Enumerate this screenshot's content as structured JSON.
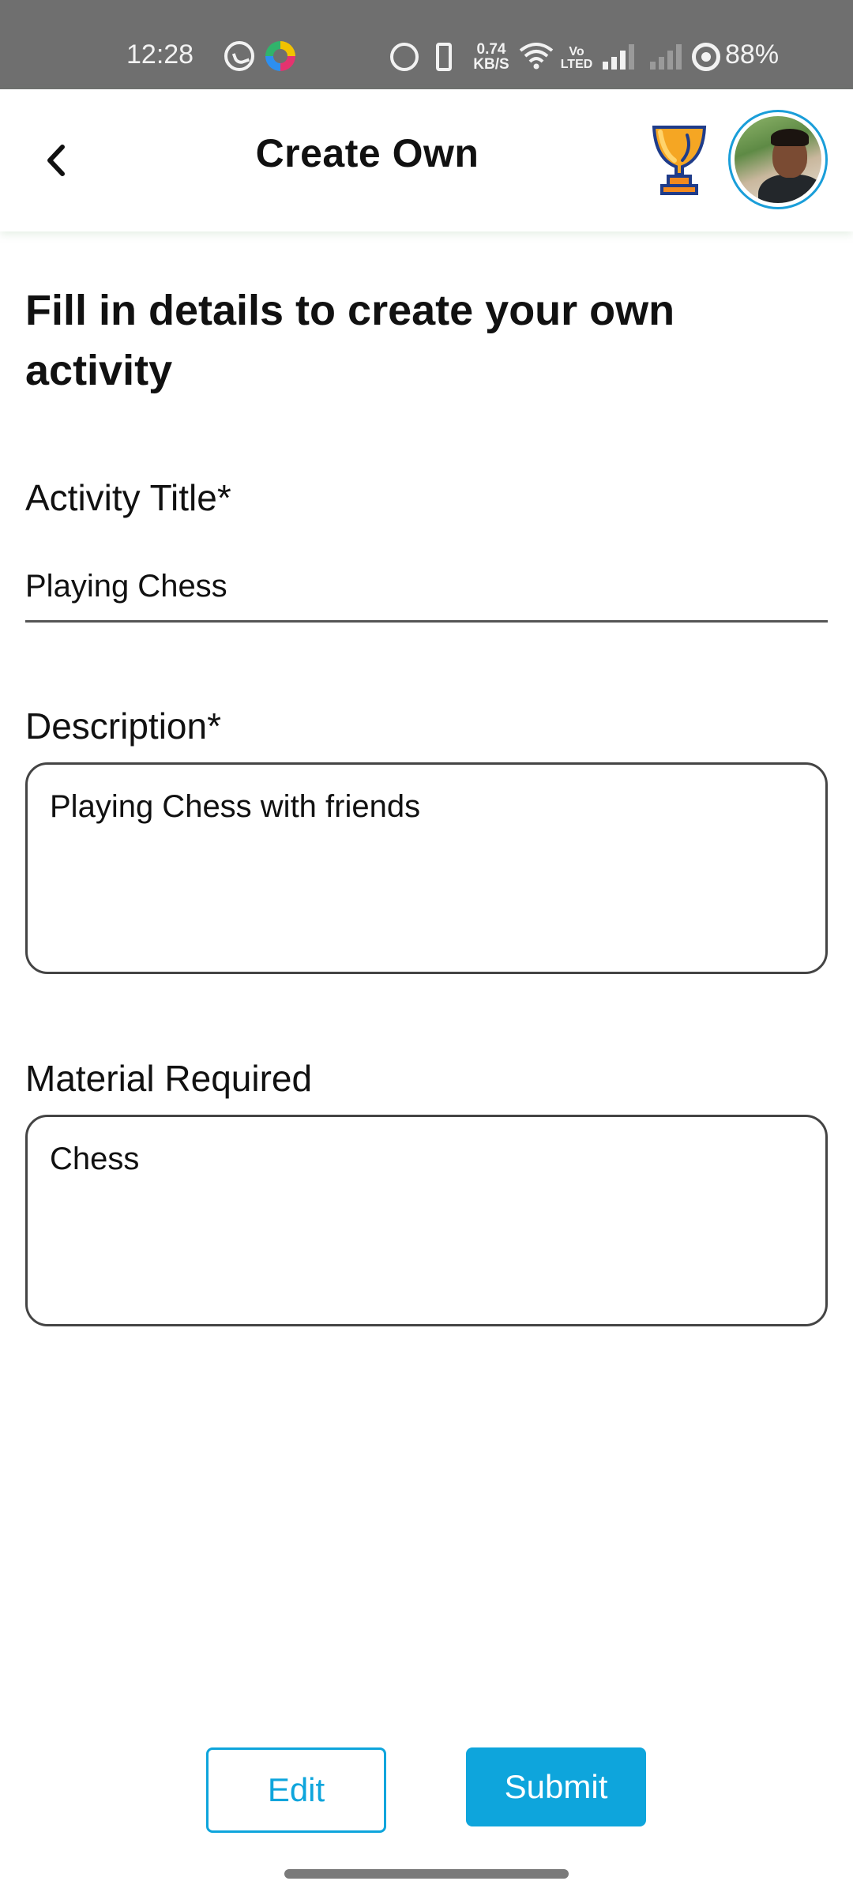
{
  "status_bar": {
    "time": "12:28",
    "speed_value": "0.74",
    "speed_unit": "KB/S",
    "volte_top": "Vo",
    "volte_bottom": "LTED",
    "battery": "88%"
  },
  "header": {
    "title": "Create Own",
    "back_icon": "chevron-left-icon",
    "trophy_icon": "trophy-icon"
  },
  "form": {
    "intro": "Fill in details to create your own activity",
    "activity_title_label": "Activity Title*",
    "activity_title_value": "Playing Chess",
    "description_label": "Description*",
    "description_value": "Playing Chess with friends",
    "material_label": "Material Required",
    "material_value": "Chess"
  },
  "actions": {
    "edit_label": "Edit",
    "submit_label": "Submit"
  },
  "colors": {
    "accent": "#0ea5dc",
    "status_bar": "#6f6f6f",
    "trophy": "#f5a623"
  }
}
